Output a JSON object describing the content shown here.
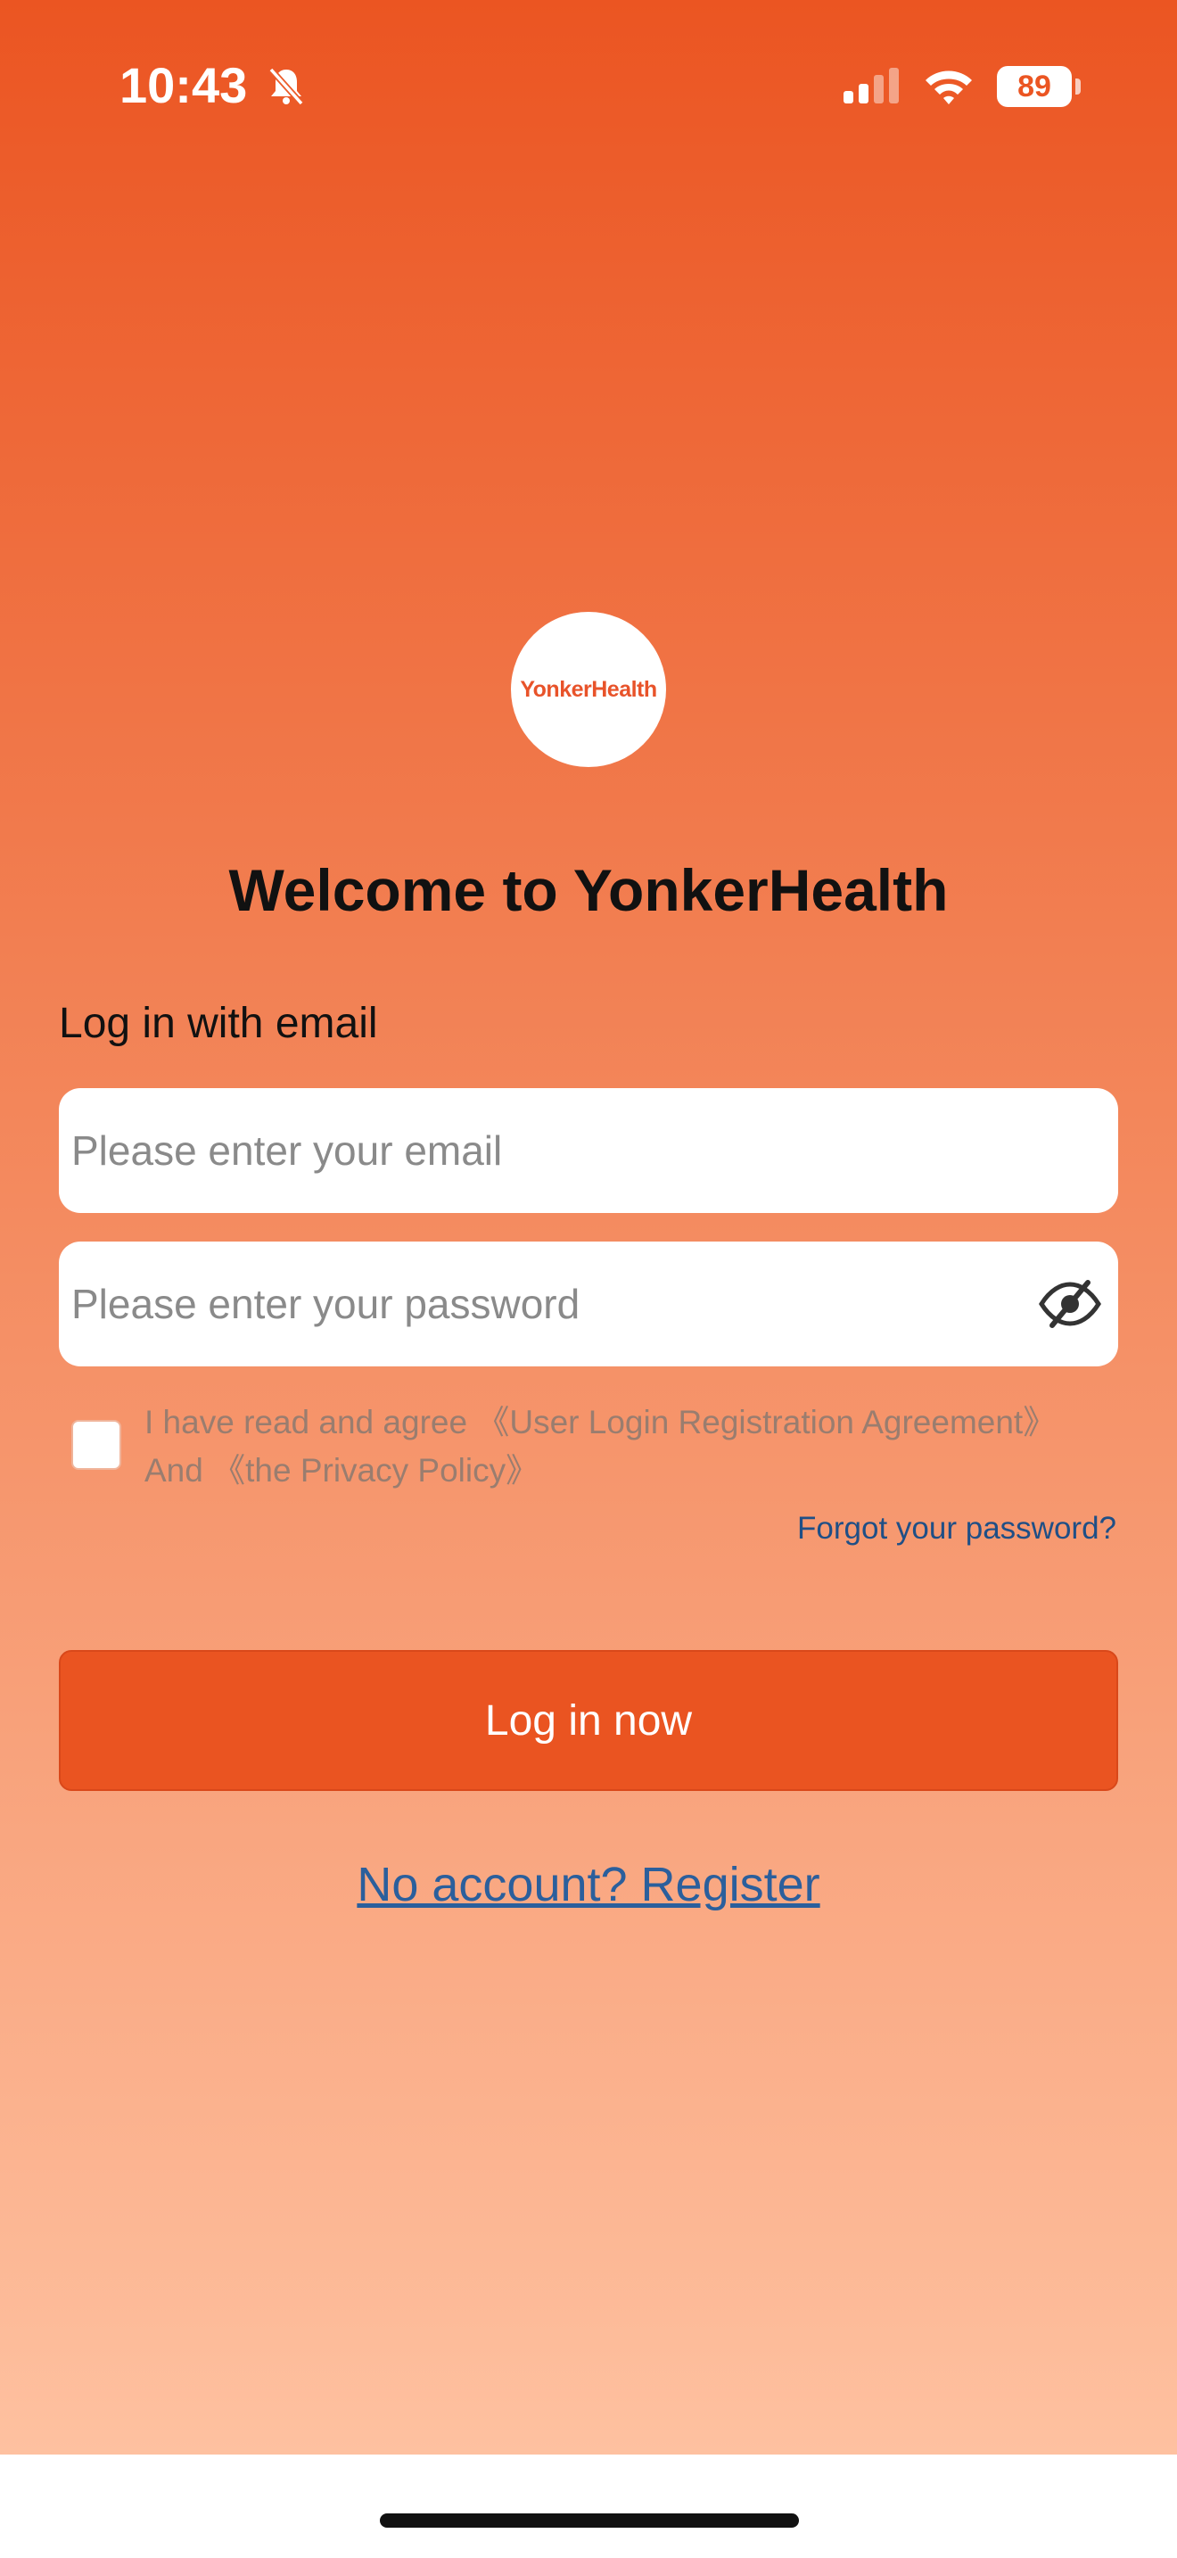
{
  "status_bar": {
    "time": "10:43",
    "battery": "89",
    "icons": [
      "bell-slash-icon",
      "cellular-signal-icon",
      "wifi-icon",
      "battery-icon"
    ]
  },
  "brand": {
    "logo_text": "YonkerHealth",
    "primary_color": "#ea5421"
  },
  "welcome_title": "Welcome to YonkerHealth",
  "login_form": {
    "section_label": "Log in with email",
    "email_placeholder": "Please enter your email",
    "password_placeholder": "Please enter your password",
    "agreement_prefix": "I have read and agree ",
    "agreement_link": "《User Login Registration Agreement》",
    "agreement_and": "And ",
    "privacy_link": "《the Privacy Policy》",
    "forgot_password": "Forgot your password?",
    "login_button": "Log in now",
    "register_link": "No account? Register"
  }
}
